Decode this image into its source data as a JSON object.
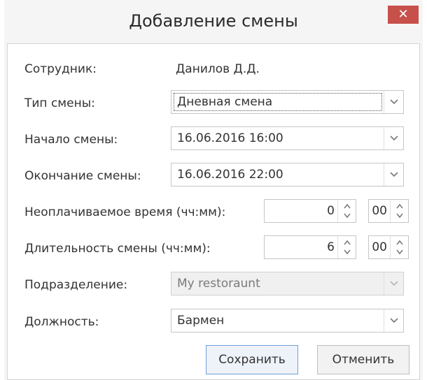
{
  "dialog": {
    "title": "Добавление смены",
    "close_glyph": "✕"
  },
  "fields": {
    "employee": {
      "label": "Сотрудник:",
      "value": "Данилов Д.Д."
    },
    "shift_type": {
      "label": "Тип смены:",
      "value": "Дневная смена"
    },
    "shift_start": {
      "label": "Начало смены:",
      "value": "16.06.2016 16:00"
    },
    "shift_end": {
      "label": "Окончание смены:",
      "value": "16.06.2016 22:00"
    },
    "unpaid_time": {
      "label": "Неоплачиваемое время (чч:мм):",
      "hours": "0",
      "minutes": "00"
    },
    "shift_duration": {
      "label": "Длительность смены (чч:мм):",
      "hours": "6",
      "minutes": "00"
    },
    "department": {
      "label": "Подразделение:",
      "value": "My restoraunt"
    },
    "position": {
      "label": "Должность:",
      "value": "Бармен"
    }
  },
  "buttons": {
    "save": "Сохранить",
    "cancel": "Отменить"
  },
  "icons": {
    "dropdown": "chevron-down-icon",
    "spinner": "up-down-arrows-icon",
    "close": "close-icon"
  },
  "colors": {
    "close_button": "#c7504b",
    "primary_border": "#6f9ed8"
  }
}
